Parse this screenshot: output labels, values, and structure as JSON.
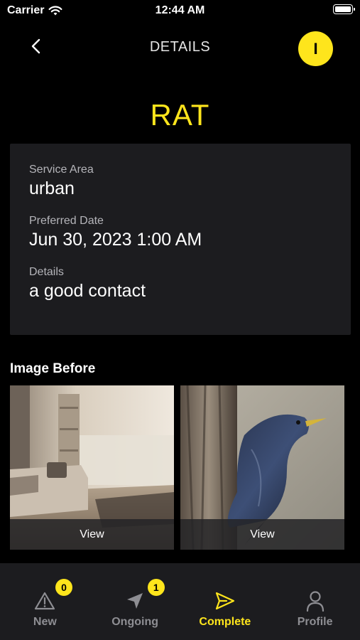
{
  "status_bar": {
    "carrier": "Carrier",
    "time": "12:44 AM"
  },
  "header": {
    "title": "DETAILS",
    "avatar_initial": "I"
  },
  "request": {
    "title": "RAT",
    "fields": [
      {
        "label": "Service Area",
        "value": "urban"
      },
      {
        "label": "Preferred Date",
        "value": "Jun 30, 2023 1:00 AM"
      },
      {
        "label": "Details",
        "value": "a good contact"
      }
    ]
  },
  "images_section": {
    "heading": "Image Before",
    "images": [
      {
        "subject": "living room",
        "view_label": "View"
      },
      {
        "subject": "starling bird on tree trunk",
        "view_label": "View"
      }
    ]
  },
  "tab_bar": {
    "tabs": [
      {
        "label": "New",
        "icon": "warning-triangle-icon",
        "badge": "0",
        "active": false
      },
      {
        "label": "Ongoing",
        "icon": "navigation-arrow-icon",
        "badge": "1",
        "active": false
      },
      {
        "label": "Complete",
        "icon": "send-icon",
        "active": true
      },
      {
        "label": "Profile",
        "icon": "person-icon",
        "active": false
      }
    ]
  },
  "colors": {
    "accent": "#fee51c",
    "background": "#000000",
    "card": "#1c1c1f",
    "muted": "#8e8e93"
  }
}
